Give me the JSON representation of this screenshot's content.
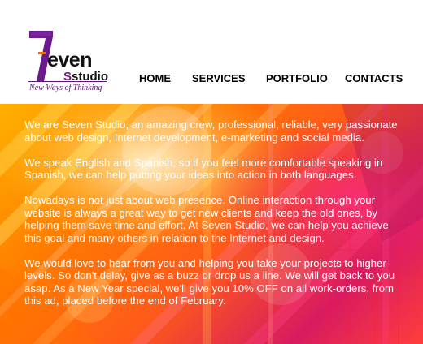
{
  "logo": {
    "word": "even",
    "sub_accent": "S",
    "sub": "studio",
    "tagline": "New Ways of Thinking",
    "colors": {
      "purple": "#6a1b8a",
      "orange": "#e8701a",
      "black": "#111111"
    }
  },
  "nav": {
    "items": [
      {
        "label": "HOME",
        "active": true
      },
      {
        "label": "SERVICES",
        "active": false
      },
      {
        "label": "PORTFOLIO",
        "active": false
      },
      {
        "label": "CONTACTS",
        "active": false
      }
    ]
  },
  "content": {
    "paragraphs": [
      "We are Seven Studio, an amazing crew, professional, reliable, very passionate about web design, Internet development, e-marketing and social media.",
      "We speak English and Spanish, so if you feel more comfortable speaking in Spanish, we can help putting your ideas into action in both languages.",
      "Nowadays is not just about web presence. Online interaction through your website is always a great way to get new clients and keep the old ones, by helping them save time and effort. At Seven Studio, we can help you achieve this goal and many others in relation to the Internet and design.",
      "We would love to hear from you and helping you take your projects to higher levels. So don't delay, give as a buzz or drop us a line. We will get back to you asap. As a New Year special, we'll give you 10% OFF on all work-orders, from this ad, placed before the end of February."
    ]
  },
  "hero": {
    "colors": [
      "#ffb100",
      "#ff7a00",
      "#ff5a1a",
      "#d81b60",
      "#ff3d3d",
      "#c2185b"
    ]
  }
}
